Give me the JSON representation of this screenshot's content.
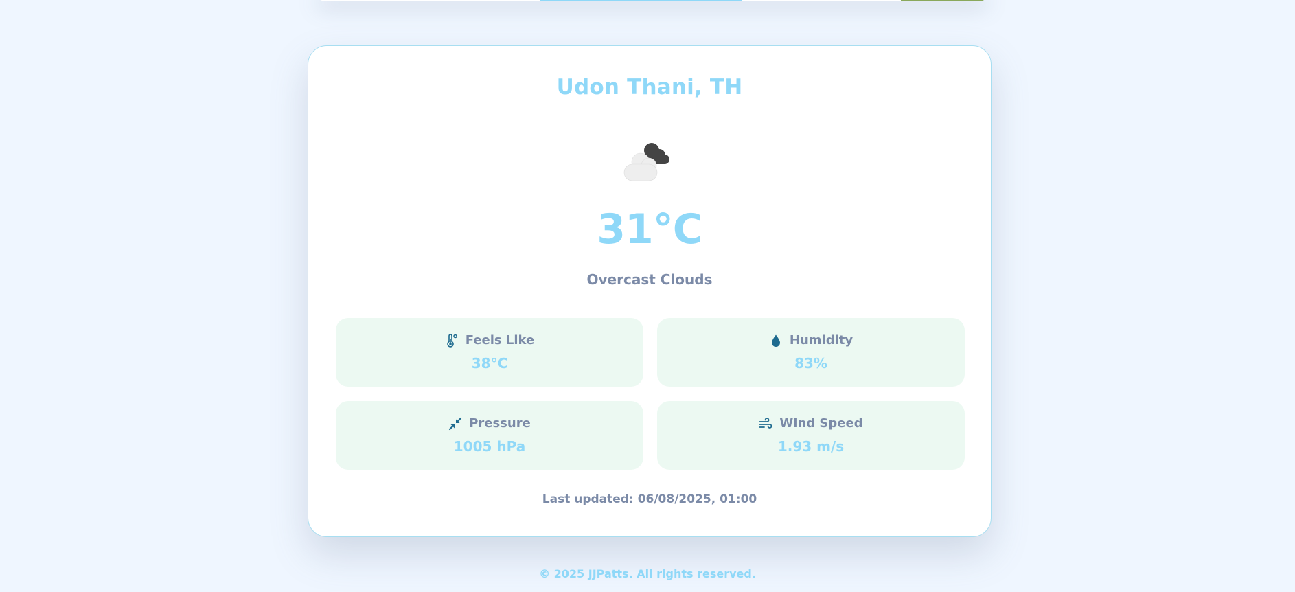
{
  "location": {
    "city": "Udon Thani, TH"
  },
  "current": {
    "icon": "overcast-clouds-icon",
    "temperature": "31°C",
    "description": "Overcast Clouds"
  },
  "stats": {
    "feels_like": {
      "label": "Feels Like",
      "value": "38°C",
      "icon": "thermometer-icon"
    },
    "humidity": {
      "label": "Humidity",
      "value": "83%",
      "icon": "droplet-icon"
    },
    "pressure": {
      "label": "Pressure",
      "value": "1005 hPa",
      "icon": "compress-arrows-icon"
    },
    "wind_speed": {
      "label": "Wind Speed",
      "value": "1.93 m/s",
      "icon": "wind-icon"
    }
  },
  "last_updated": "Last updated: 06/08/2025, 01:00",
  "footer": {
    "copyright": "© 2025 JJPatts. All rights reserved."
  },
  "colors": {
    "accent": "#8fd8f8",
    "muted_text": "#7b8aa7",
    "stat_bg": "#ecf9f2",
    "icon_dark": "#1e6b8f",
    "page_bg": "#eff6ff"
  }
}
